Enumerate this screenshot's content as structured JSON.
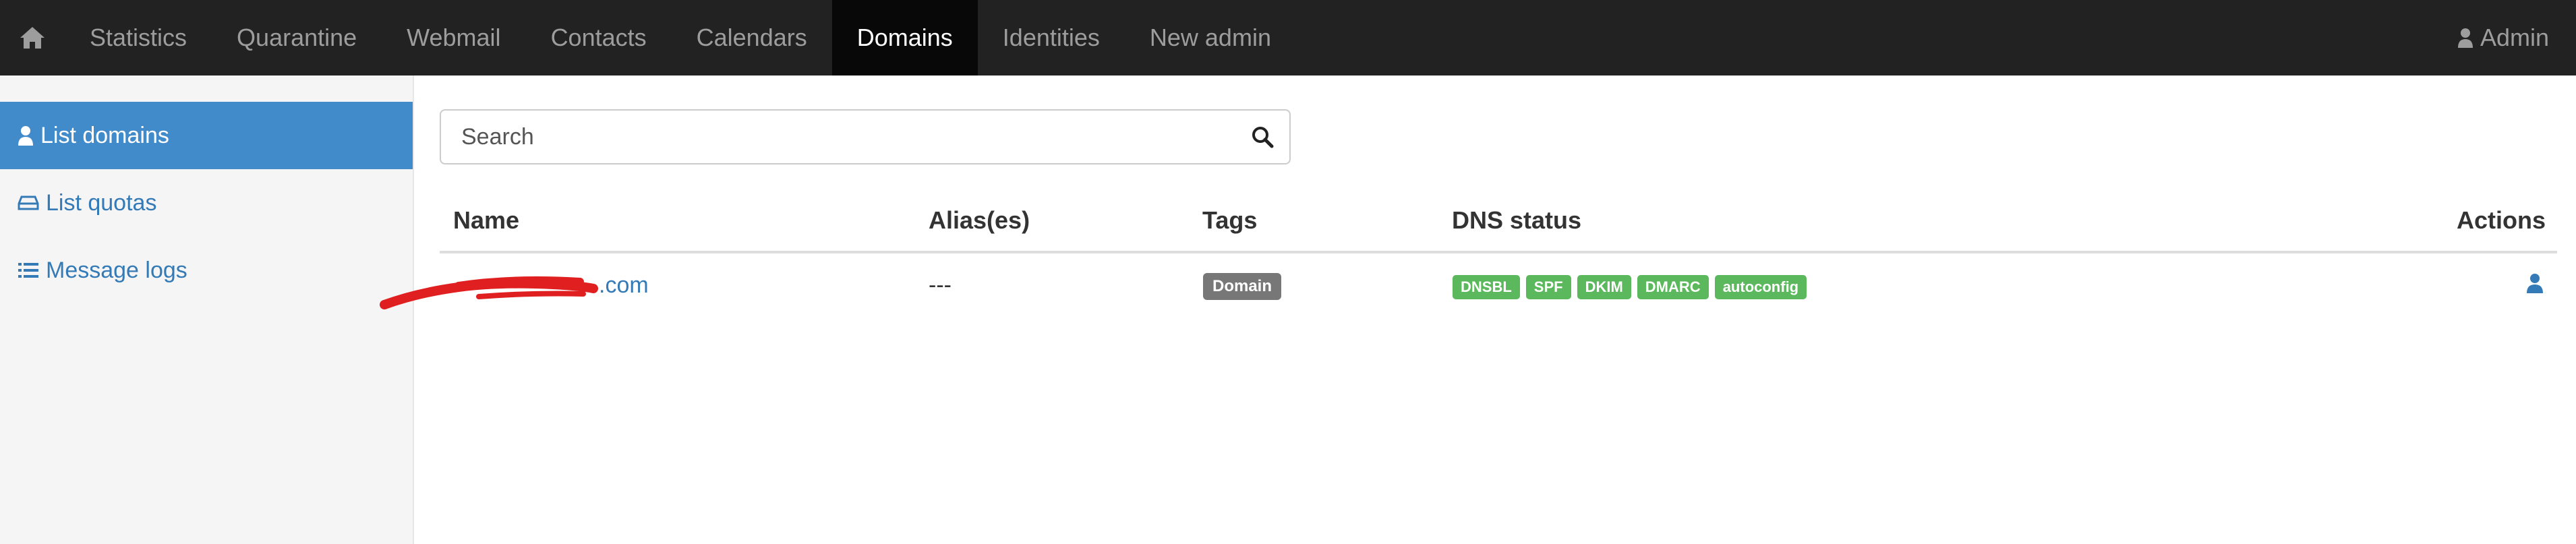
{
  "nav": {
    "items": [
      "Statistics",
      "Quarantine",
      "Webmail",
      "Contacts",
      "Calendars",
      "Domains",
      "Identities",
      "New admin"
    ],
    "active": "Domains",
    "user_label": "Admin"
  },
  "sidebar": {
    "items": [
      {
        "label": "List domains",
        "icon": "user-icon",
        "active": true
      },
      {
        "label": "List quotas",
        "icon": "hdd-icon",
        "active": false
      },
      {
        "label": "Message logs",
        "icon": "list-icon",
        "active": false
      }
    ]
  },
  "search": {
    "placeholder": "Search"
  },
  "table": {
    "columns": [
      "Name",
      "Alias(es)",
      "Tags",
      "DNS status",
      "Actions"
    ],
    "rows": [
      {
        "name_visible": ".com",
        "aliases": "---",
        "tag": "Domain",
        "dns": [
          "DNSBL",
          "SPF",
          "DKIM",
          "DMARC",
          "autoconfig"
        ]
      }
    ]
  },
  "colors": {
    "navbar": "#222222",
    "nav_active": "#080808",
    "sidebar_active": "#428bca",
    "link": "#337ab7",
    "badge_green": "#5cb85c",
    "tag_gray": "#777777",
    "redaction": "#e02020"
  }
}
